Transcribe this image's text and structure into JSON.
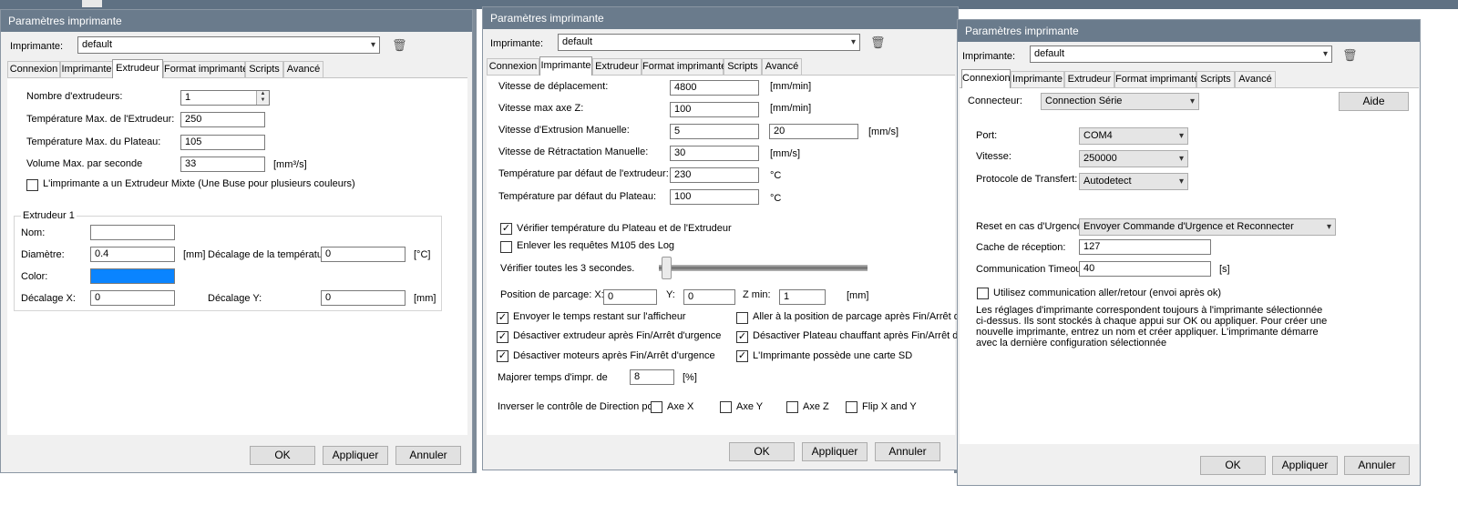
{
  "title": "Paramètres imprimante",
  "printer_label": "Imprimante:",
  "printer_value": "default",
  "tabs": [
    "Connexion",
    "Imprimante",
    "Extrudeur",
    "Format imprimante",
    "Scripts",
    "Avancé"
  ],
  "buttons": {
    "ok": "OK",
    "apply": "Appliquer",
    "cancel": "Annuler",
    "help": "Aide"
  },
  "extruder_tab": {
    "num_extruders_label": "Nombre d'extrudeurs:",
    "num_extruders": "1",
    "max_extruder_temp_label": "Température Max. de l'Extrudeur:",
    "max_extruder_temp": "250",
    "max_bed_temp_label": "Température Max. du Plateau:",
    "max_bed_temp": "105",
    "max_volume_label": "Volume Max. par seconde",
    "max_volume": "33",
    "volume_unit": "[mm³/s]",
    "mixing_label": "L'imprimante a un Extrudeur Mixte (Une Buse pour plusieurs couleurs)",
    "extruder1": {
      "group_title": "Extrudeur 1",
      "name_label": "Nom:",
      "name": "",
      "diameter_label": "Diamètre:",
      "diameter": "0.4",
      "mm": "[mm]",
      "temp_offset_label": "Décalage de la température:",
      "temp_offset": "0",
      "temp_unit": "[°C]",
      "color_label": "Color:",
      "color": "#0a84ff",
      "offset_x_label": "Décalage X:",
      "offset_x": "0",
      "offset_y_label": "Décalage Y:",
      "offset_y": "0",
      "mm2": "[mm]"
    }
  },
  "printer_tab": {
    "travel_speed_label": "Vitesse de déplacement:",
    "travel_speed": "4800",
    "unit_mmmin": "[mm/min]",
    "z_speed_label": "Vitesse max axe Z:",
    "z_speed": "100",
    "unit_mmmin2": "[mm/min]",
    "manual_extrusion_label": "Vitesse d'Extrusion Manuelle:",
    "manual_extrusion_1": "5",
    "manual_extrusion_2": "20",
    "unit_mms": "[mm/s]",
    "manual_retraction_label": "Vitesse de Rétractation Manuelle:",
    "manual_retraction": "30",
    "unit_mms2": "[mm/s]",
    "default_extruder_temp_label": "Température par défaut de l'extrudeur:",
    "default_extruder_temp": "230",
    "unit_c": "°C",
    "default_bed_temp_label": "Température par défaut du Plateau:",
    "default_bed_temp": "100",
    "unit_c2": "°C",
    "check_temp_label": "Vérifier température du Plateau et de l'Extrudeur",
    "check_temp": true,
    "remove_m105_label": "Enlever les requêtes M105 des Log",
    "remove_m105": false,
    "check_every_label": "Vérifier toutes les 3 secondes.",
    "check_every_level": 0,
    "park_label": "Position de parcage: X:",
    "park_x": "0",
    "park_y_label": "Y:",
    "park_y": "0",
    "park_zmin_label": "Z min:",
    "park_zmin": "1",
    "park_unit": "[mm]",
    "send_remaining_label": "Envoyer le temps restant sur l'afficheur",
    "send_remaining": true,
    "goto_park_label": "Aller à la position de parcage après Fin/Arrêt d'urg",
    "goto_park": false,
    "disable_extruder_label": "Désactiver extrudeur après Fin/Arrêt d'urgence",
    "disable_extruder": true,
    "disable_bed_label": "Désactiver Plateau chauffant après Fin/Arrêt d'urg",
    "disable_bed": true,
    "disable_motors_label": "Désactiver moteurs après Fin/Arrêt d'urgence",
    "disable_motors": true,
    "sd_card_label": "L'Imprimante possède une carte SD",
    "sd_card": true,
    "increase_time_label": "Majorer temps d'impr. de",
    "increase_time": "8",
    "percent_unit": "[%]",
    "invert_label": "Inverser le contrôle de Direction pour",
    "axis_x_label": "Axe X",
    "axis_y_label": "Axe Y",
    "axis_z_label": "Axe Z",
    "flip_xy_label": "Flip X and Y"
  },
  "connection_tab": {
    "connector_label": "Connecteur:",
    "connector": "Connection Série",
    "port_label": "Port:",
    "port": "COM4",
    "speed_label": "Vitesse:",
    "speed": "250000",
    "protocol_label": "Protocole de Transfert:",
    "protocol": "Autodetect",
    "reset_label": "Reset en cas d'Urgence",
    "reset": "Envoyer Commande d'Urgence et Reconnecter",
    "cache_label": "Cache de réception:",
    "cache": "127",
    "timeout_label": "Communication Timeout:",
    "timeout": "40",
    "timeout_unit": "[s]",
    "pingpong_label": "Utilisez communication aller/retour (envoi après ok)",
    "pingpong": false,
    "note_line1": "Les réglages d'imprimante correspondent toujours à l'imprimante sélectionnée",
    "note_line2": "ci-dessus. Ils sont stockés à chaque appui sur OK ou appliquer. Pour créer une",
    "note_line3": "nouvelle imprimante, entrez un nom et créer appliquer. L'imprimante démarre",
    "note_line4": "avec la dernière configuration sélectionnée"
  },
  "colors": {
    "titlebar": "#6a7b8c",
    "dialog": "#f0f0f0",
    "color_swatch": "#0a84ff"
  }
}
